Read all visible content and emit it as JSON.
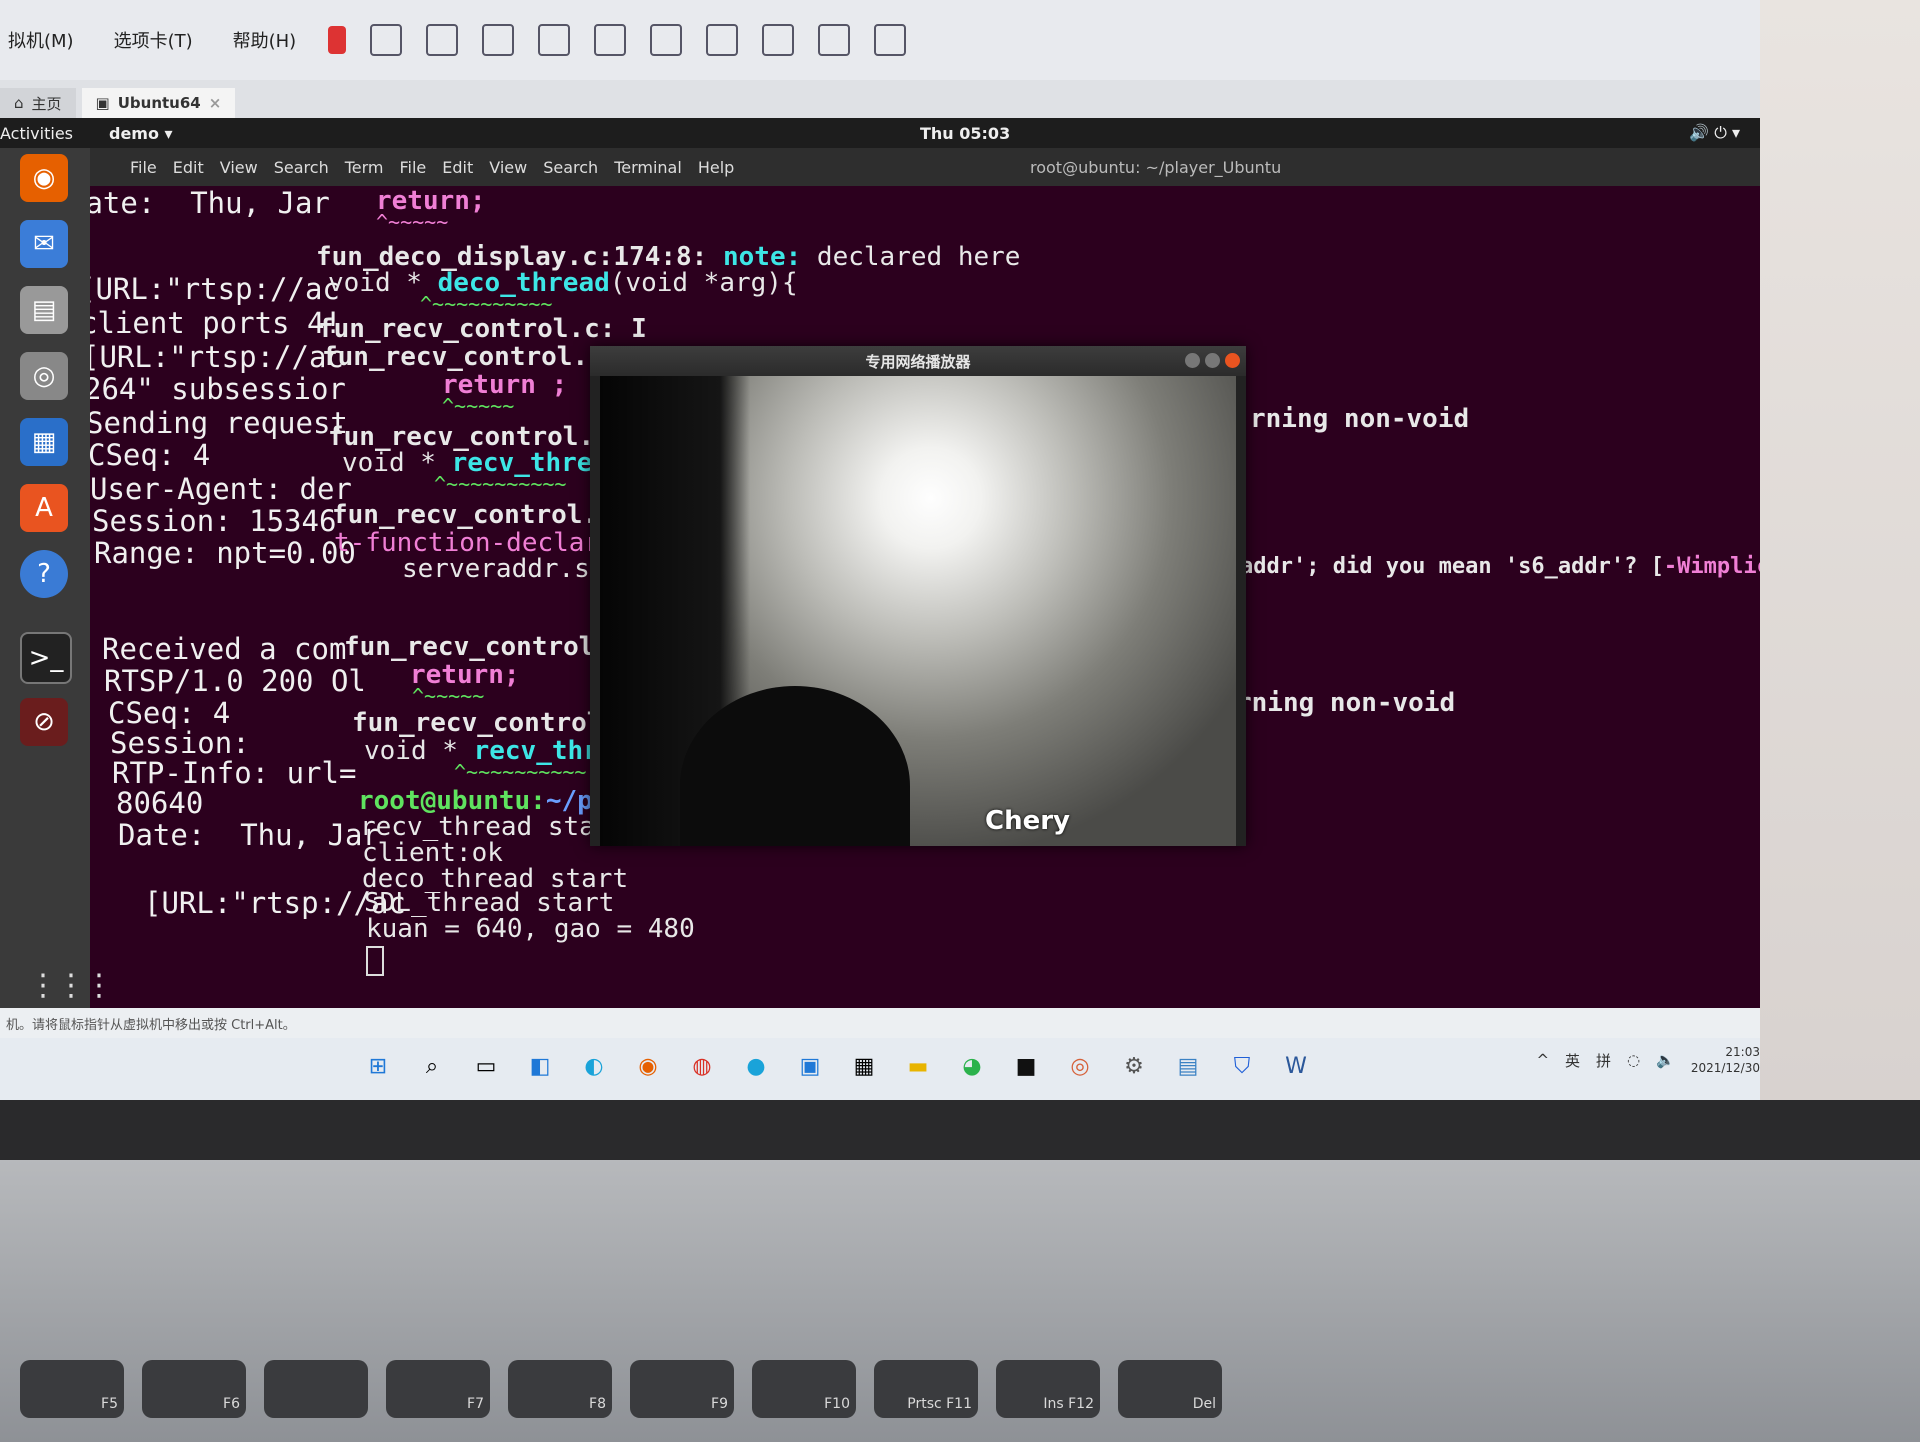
{
  "vmware": {
    "menus": [
      "拟机(M)",
      "选项卡(T)",
      "帮助(H)"
    ],
    "tabs": [
      {
        "label": "主页",
        "icon": "home-icon"
      },
      {
        "label": "Ubuntu64",
        "icon": "vm-icon"
      }
    ],
    "status_hint": "机。请将鼠标指针从虚拟机中移出或按 Ctrl+Alt。"
  },
  "ubuntu": {
    "activities": "Activities",
    "app_menu": "demo ▾",
    "clock": "Thu 05:03",
    "terminal_title": "root@ubuntu: ~/player_Ubuntu",
    "terminal_menu": [
      "File",
      "Edit",
      "View",
      "Search",
      "Term",
      "File",
      "Edit",
      "View",
      "Search",
      "Terminal",
      "Help"
    ]
  },
  "terminal": {
    "left_lines": [
      "Date:  Thu, Jar",
      "[URL:\"rtsp://ac",
      "client ports 4!",
      "[URL:\"rtsp://ac",
      "264\" subsessior",
      "Sending request",
      "CSeq: 4",
      "User-Agent: der",
      "Session: 15346",
      "Range: npt=0.00",
      "Received a com",
      "RTSP/1.0 200 Ol",
      "CSeq: 4",
      "Session:",
      "RTP-Info: url=",
      "80640",
      "Date:  Thu, Jar",
      "[URL:\"rtsp://ac"
    ],
    "mid": {
      "l1": "return;",
      "l1u": "^~~~~~",
      "l2a": "fun_deco_display.c:174:8: ",
      "l2b": "note:",
      "l2c": " declared here",
      "l3a": "void * ",
      "l3b": "deco_thread",
      "l3c": "(void *arg){",
      "l3u": "^~~~~~~~~~~",
      "l4": "fun_recv_control.c: I",
      "l5": "fun_recv_control.c:41",
      "l6": "return ;",
      "l6u": "^~~~~~",
      "l7": "fun_recv_control.c:19",
      "l8a": "void * ",
      "l8b": "recv_thread",
      "l8c": "(v",
      "l8u": "^~~~~~~~~~~",
      "l9": "fun_recv_control.c:56",
      "l10": "t-function-declaratio",
      "l11": "serveraddr.sin_a",
      "l12": "fun_recv_control.c:96",
      "l13": "return;",
      "l13u": "^~~~~~",
      "l14": "fun_recv_control.c:19",
      "l15a": "void * ",
      "l15b": "recv_thread",
      "l15c": "(v",
      "l15u": "^~~~~~~~~~~",
      "l16": "root@ubuntu:",
      "l16b": "~/player_",
      "l17": "recv_thread start",
      "l18": "client:ok",
      "l19": "deco_thread start",
      "l20": "SDL_thread start",
      "l21": "kuan = 640, gao = 480"
    },
    "right": {
      "r1": "rning non-void",
      "r2a": "addr'; did you mean 's6_addr'? [",
      "r2b": "-Wimplici",
      "r3": "rning non-void"
    }
  },
  "player": {
    "title": "专用网络播放器",
    "caption": "Chery"
  },
  "windows": {
    "tray_lang": "英",
    "tray_ime": "拼",
    "time": "21:03",
    "date": "2021/12/30"
  },
  "keyboard": [
    "F5",
    "F6",
    "",
    "F7",
    "F8",
    "F9",
    "F10",
    "Prtsc F11",
    "Ins F12",
    "Del"
  ]
}
